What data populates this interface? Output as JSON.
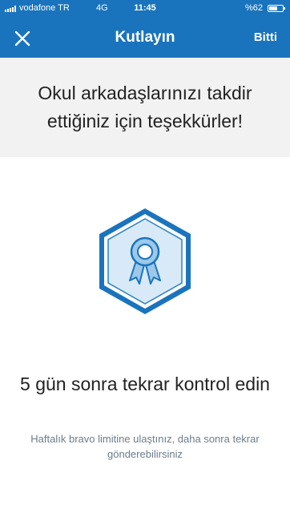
{
  "status_bar": {
    "carrier": "vodafone TR",
    "network": "4G",
    "time": "11:45",
    "battery": "%62",
    "battery_level": 0.62
  },
  "nav": {
    "title": "Kutlayın",
    "done_label": "Bitti",
    "close_icon": "close-icon"
  },
  "header": {
    "message": "Okul arkadaşlarınızı takdir ettiğiniz için teşekkürler!"
  },
  "main": {
    "badge_icon": "award-ribbon-icon",
    "headline": "5 gün sonra tekrar kontrol edin",
    "subtext": "Haftalık bravo limitine ulaştınız, daha sonra tekrar gönderebilirsiniz"
  },
  "colors": {
    "brand": "#1a74bd",
    "header_bg": "#f2f2f2",
    "badge_fill": "#d8eaf7",
    "badge_stroke": "#1a74bd"
  }
}
